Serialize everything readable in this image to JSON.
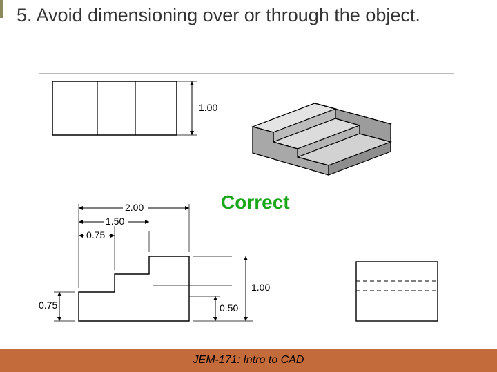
{
  "title": "5. Avoid dimensioning over or through the object.",
  "correct_label": "Correct",
  "footer": "JEM-171: Intro to CAD",
  "dims": {
    "d1_00_top": "1.00",
    "d2_00": "2.00",
    "d1_50": "1.50",
    "d0_75_h": "0.75",
    "d0_75_v": "0.75",
    "d1_00_bot": "1.00",
    "d0_50": "0.50"
  },
  "colors": {
    "accent": "#8a8a5c",
    "footer_bg": "#c46b3c",
    "correct": "#1aa81a"
  }
}
